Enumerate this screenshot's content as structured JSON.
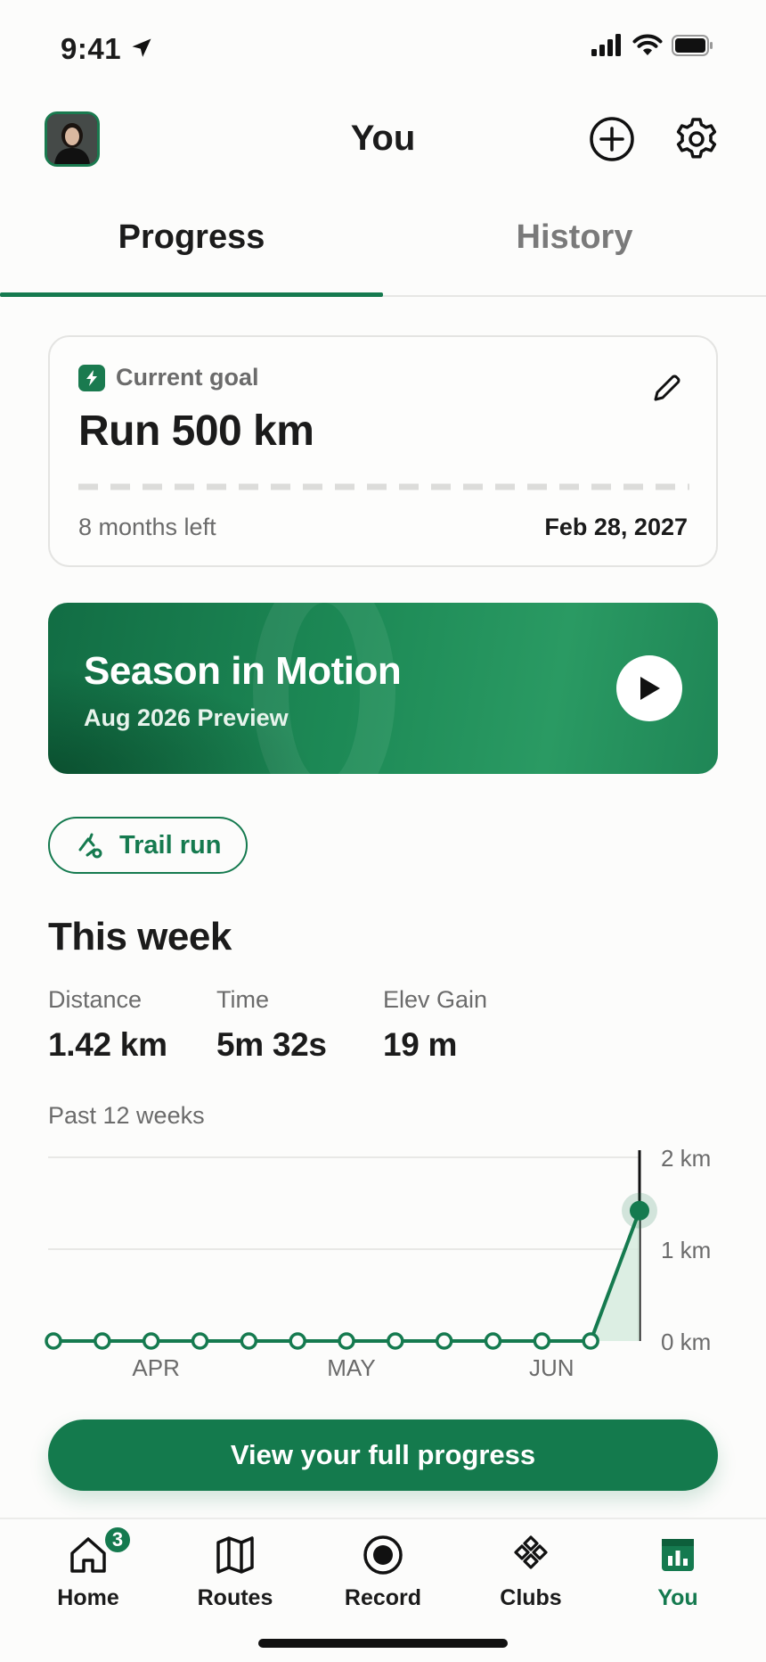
{
  "status_bar": {
    "time": "9:41"
  },
  "header": {
    "title": "You"
  },
  "tabs": [
    {
      "label": "Progress",
      "active": true
    },
    {
      "label": "History",
      "active": false
    }
  ],
  "goal": {
    "label": "Current goal",
    "title": "Run 500 km",
    "progress": 0,
    "time_left": "8 months left",
    "end_date": "Feb 28, 2027"
  },
  "season": {
    "title": "Season in Motion",
    "subtitle": "Aug 2026 Preview"
  },
  "activity_chip": {
    "label": "Trail run"
  },
  "this_week": {
    "title": "This week",
    "stats": [
      {
        "label": "Distance",
        "value": "1.42 km"
      },
      {
        "label": "Time",
        "value": "5m 32s"
      },
      {
        "label": "Elev Gain",
        "value": "19 m"
      }
    ]
  },
  "chart_data": {
    "type": "line",
    "title": "Past 12 weeks",
    "x_tick_labels": [
      "APR",
      "MAY",
      "JUN"
    ],
    "y_tick_labels": [
      "2 km",
      "1 km",
      "0 km"
    ],
    "ylim": [
      0,
      2
    ],
    "grid": true,
    "series": [
      {
        "values": [
          0,
          0,
          0,
          0,
          0,
          0,
          0,
          0,
          0,
          0,
          0,
          0,
          1.42
        ]
      }
    ],
    "highlight_index": 12
  },
  "cta": {
    "label": "View your full progress"
  },
  "bottom_nav": {
    "items": [
      {
        "label": "Home",
        "icon": "home-icon",
        "badge": "3"
      },
      {
        "label": "Routes",
        "icon": "map-icon"
      },
      {
        "label": "Record",
        "icon": "record-icon"
      },
      {
        "label": "Clubs",
        "icon": "clubs-icon"
      },
      {
        "label": "You",
        "icon": "you-icon",
        "active": true
      }
    ]
  },
  "colors": {
    "accent": "#157a4f",
    "accent_light": "#d6ebde",
    "text": "#1b1b1b",
    "muted": "#6b6b6b"
  }
}
